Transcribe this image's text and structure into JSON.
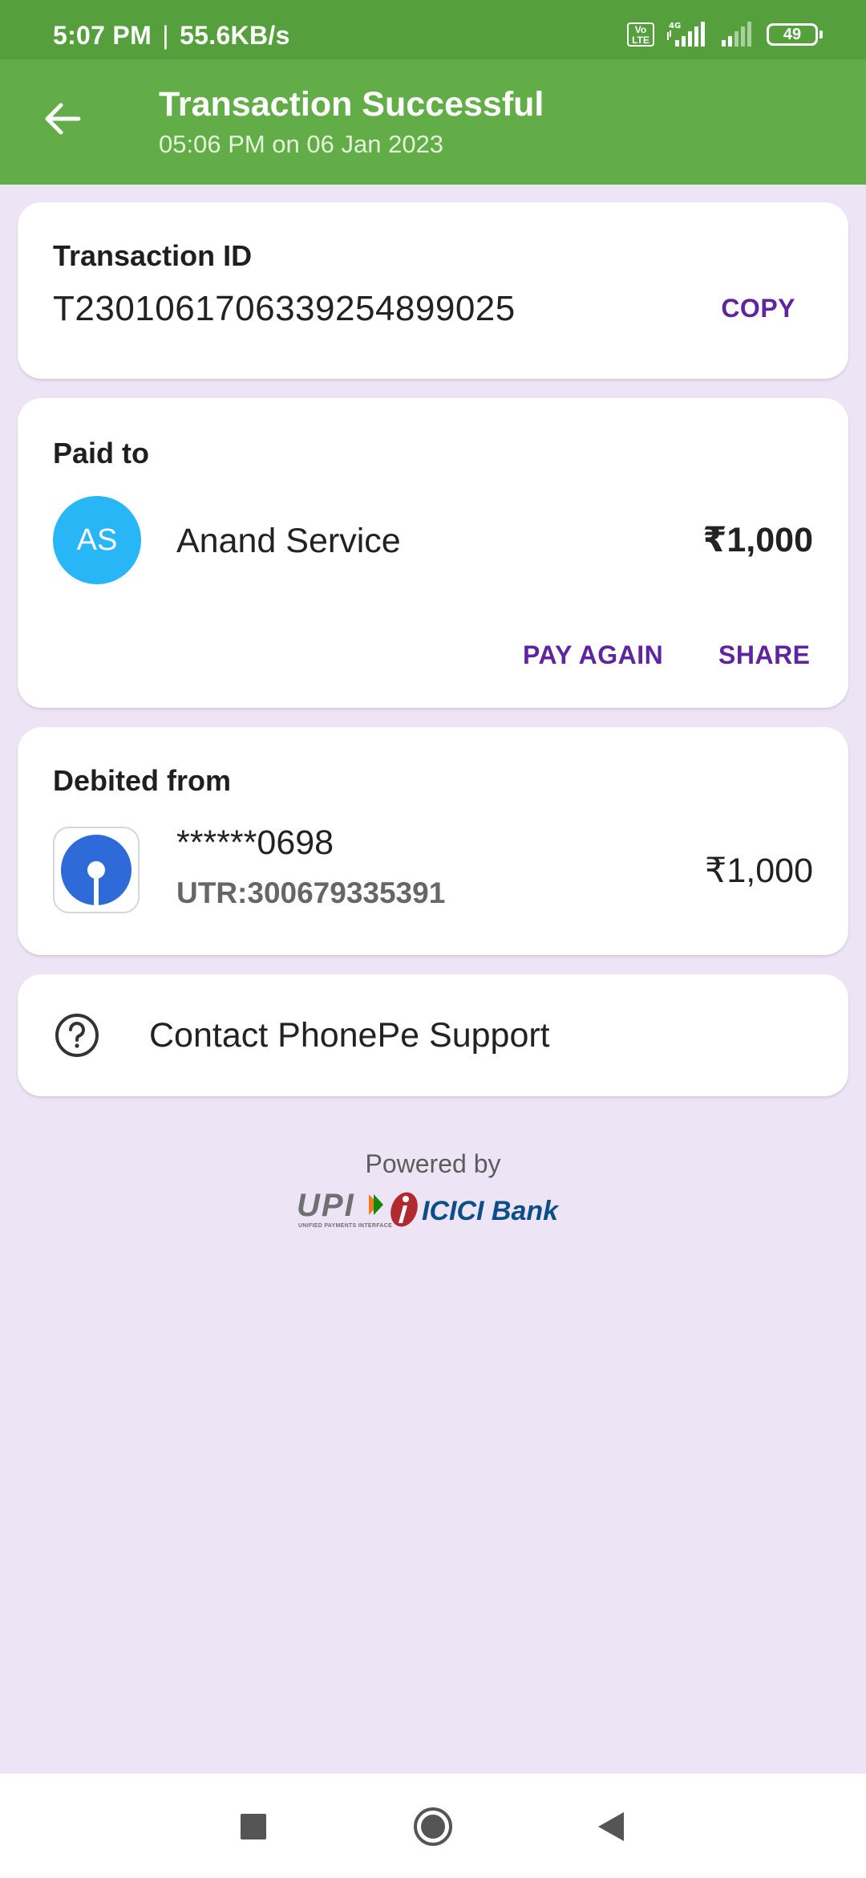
{
  "status_bar": {
    "time": "5:07 PM",
    "separator": "|",
    "speed": "55.6KB/s",
    "volte_label": "Vo LTE",
    "network_label": "4G",
    "battery": "49"
  },
  "header": {
    "title": "Transaction Successful",
    "subtitle": "05:06 PM on 06 Jan 2023"
  },
  "transaction": {
    "label": "Transaction ID",
    "id": "T2301061706339254899025",
    "copy_label": "COPY"
  },
  "paid_to": {
    "label": "Paid to",
    "avatar_initials": "AS",
    "name": "Anand Service",
    "amount": "₹1,000",
    "pay_again_label": "PAY AGAIN",
    "share_label": "SHARE"
  },
  "debited_from": {
    "label": "Debited from",
    "account": "******0698",
    "utr": "UTR:300679335391",
    "amount": "₹1,000"
  },
  "support": {
    "label": "Contact PhonePe Support"
  },
  "footer": {
    "powered_by": "Powered by",
    "upi_text": "UPI",
    "upi_subtext": "UNIFIED PAYMENTS INTERFACE",
    "bank_text": "ICICI Bank"
  },
  "colors": {
    "status_bar": "#55a03d",
    "header": "#62ad47",
    "background": "#ede4f6",
    "accent_purple": "#5f259f",
    "avatar": "#29b6f6",
    "sbi_blue": "#2f6bd8"
  }
}
